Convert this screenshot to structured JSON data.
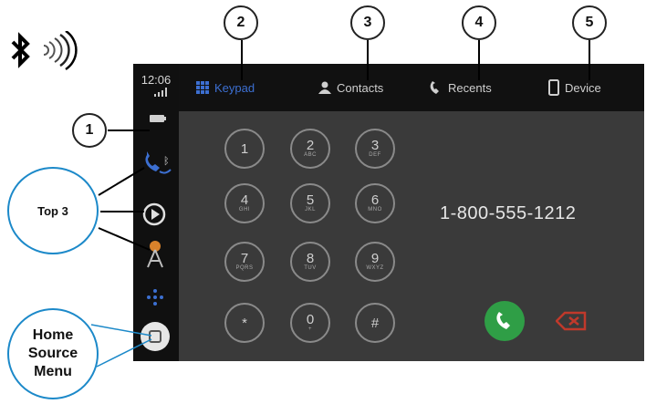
{
  "status": {
    "time": "12:06"
  },
  "tabs": [
    {
      "label": "Keypad",
      "icon": "grid-icon",
      "active": true
    },
    {
      "label": "Contacts",
      "icon": "person-icon",
      "active": false
    },
    {
      "label": "Recents",
      "icon": "phone-handset-icon",
      "active": false
    },
    {
      "label": "Device",
      "icon": "phone-device-icon",
      "active": false
    }
  ],
  "keypad": [
    {
      "digit": "1",
      "sub": ""
    },
    {
      "digit": "2",
      "sub": "ABC"
    },
    {
      "digit": "3",
      "sub": "DEF"
    },
    {
      "digit": "4",
      "sub": "GHI"
    },
    {
      "digit": "5",
      "sub": "JKL"
    },
    {
      "digit": "6",
      "sub": "MNO"
    },
    {
      "digit": "7",
      "sub": "PQRS"
    },
    {
      "digit": "8",
      "sub": "TUV"
    },
    {
      "digit": "9",
      "sub": "WXYZ"
    },
    {
      "digit": "*",
      "sub": ""
    },
    {
      "digit": "0",
      "sub": "+"
    },
    {
      "digit": "#",
      "sub": ""
    }
  ],
  "dialed_number": "1-800-555-1212",
  "callouts": {
    "c1": "1",
    "c2": "2",
    "c3": "3",
    "c4": "4",
    "c5": "5",
    "top3": "Top 3",
    "home_line1": "Home",
    "home_line2": "Source",
    "home_line3": "Menu"
  },
  "colors": {
    "active_tab": "#3c6fd1",
    "call_button": "#2f9e46",
    "backspace": "#c0392b",
    "callout_blue": "#1c89c9"
  }
}
